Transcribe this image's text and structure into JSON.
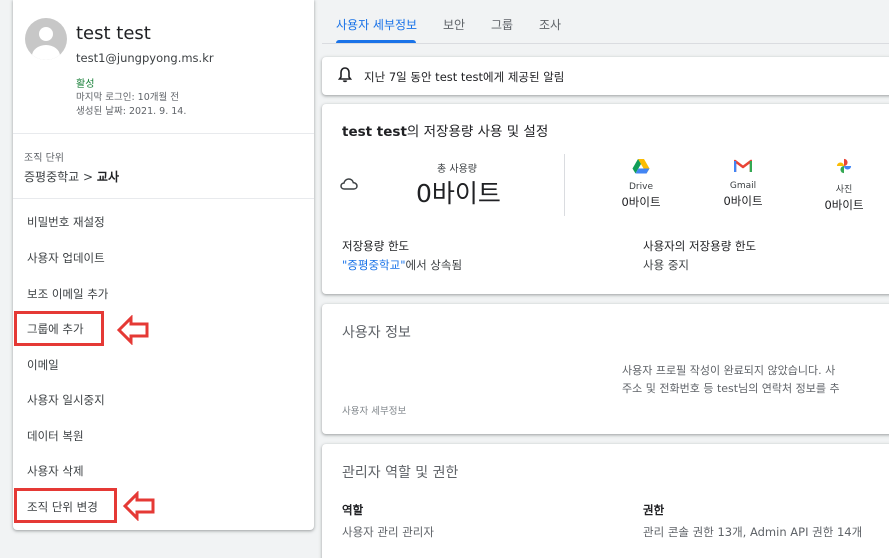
{
  "user": {
    "name": "test test",
    "email": "test1@jungpyong.ms.kr",
    "status": "활성",
    "last_login": "마지막 로그인: 10개월 전",
    "created": "생성된 날짜: 2021. 9. 14."
  },
  "org": {
    "label": "조직 단위",
    "parent": "증평중학교",
    "separator": ">",
    "current": "교사"
  },
  "actions": [
    "비밀번호 재설정",
    "사용자 업데이트",
    "보조 이메일 추가",
    "그룹에 추가",
    "이메일",
    "사용자 일시중지",
    "데이터 복원",
    "사용자 삭제",
    "조직 단위 변경"
  ],
  "tabs": [
    "사용자 세부정보",
    "보안",
    "그룹",
    "조사"
  ],
  "alert": {
    "icon": "bell-icon",
    "text": "지난 7일 동안 test test에게 제공된 알림"
  },
  "storage": {
    "title_bold": "test test",
    "title_rest": "의 저장용량 사용 및 설정",
    "total_label": "총 사용량",
    "total_value": "0바이트",
    "services": [
      {
        "name": "Drive",
        "value": "0바이트",
        "icon": "drive-icon"
      },
      {
        "name": "Gmail",
        "value": "0바이트",
        "icon": "gmail-icon"
      },
      {
        "name": "사진",
        "value": "0바이트",
        "icon": "photos-icon"
      }
    ],
    "quota_label": "저장용량 한도",
    "quota_link": "\"증평중학교\"",
    "quota_rest": "에서 상속됨",
    "user_quota_label": "사용자의 저장용량 한도",
    "user_quota_value": "사용 중지"
  },
  "user_info": {
    "title": "사용자 정보",
    "line1": "사용자 프로필 작성이 완료되지 않았습니다. 사",
    "line2": "주소 및 전화번호 등 test님의 연락처 정보를 추",
    "footer": "사용자 세부정보"
  },
  "roles": {
    "title": "관리자 역할 및 권한",
    "role_header": "역할",
    "role_value": "사용자 관리 관리자",
    "perm_header": "권한",
    "perm_value": "관리 콘솔 권한 13개, Admin API 권한 14개"
  },
  "colors": {
    "accent": "#1a73e8",
    "active_status": "#188038",
    "highlight": "#e53935"
  }
}
